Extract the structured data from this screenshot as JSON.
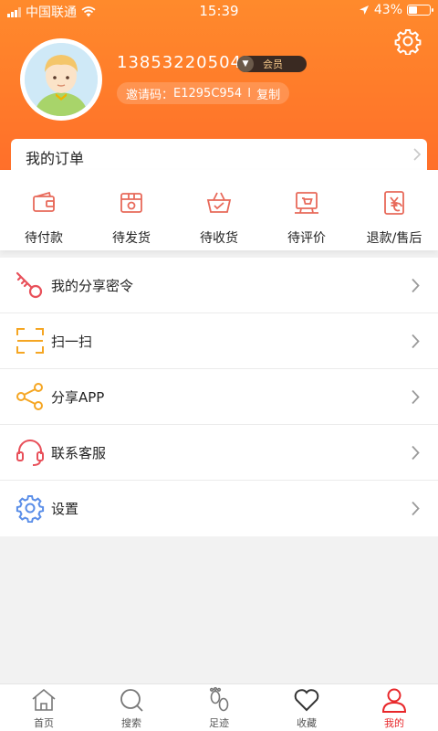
{
  "status_bar": {
    "carrier": "中国联通",
    "time": "15:39",
    "battery": "43%",
    "battery_level": 0.43
  },
  "profile": {
    "phone": "13853220504",
    "member_badge": "会员",
    "invite_label": "邀请码：",
    "invite_code": "E1295C954",
    "separator": "I",
    "copy_label": "复制"
  },
  "orders": {
    "title": "我的订单",
    "items": [
      {
        "label": "待付款",
        "icon": "wallet-icon"
      },
      {
        "label": "待发货",
        "icon": "package-icon"
      },
      {
        "label": "待收货",
        "icon": "basket-icon"
      },
      {
        "label": "待评价",
        "icon": "review-icon"
      },
      {
        "label": "退款/售后",
        "icon": "refund-icon"
      }
    ]
  },
  "menu": [
    {
      "label": "我的分享密令",
      "icon": "key-icon"
    },
    {
      "label": "扫一扫",
      "icon": "scan-icon"
    },
    {
      "label": "分享APP",
      "icon": "share-icon"
    },
    {
      "label": "联系客服",
      "icon": "headset-icon"
    },
    {
      "label": "设置",
      "icon": "settings-icon"
    }
  ],
  "tabbar": [
    {
      "label": "首页",
      "icon": "home-icon"
    },
    {
      "label": "搜索",
      "icon": "search-icon"
    },
    {
      "label": "足迹",
      "icon": "footprint-icon"
    },
    {
      "label": "收藏",
      "icon": "heart-icon"
    },
    {
      "label": "我的",
      "icon": "user-icon",
      "active": true
    }
  ],
  "colors": {
    "header": "#ff7a2a",
    "order_icon": "#e8695a",
    "active_tab": "#e8272a",
    "key_icon": "#e8505a",
    "scan_icon": "#f5a623",
    "share_icon": "#f5a623",
    "headset_icon": "#e8505a",
    "settings_icon": "#5a8ee8"
  }
}
